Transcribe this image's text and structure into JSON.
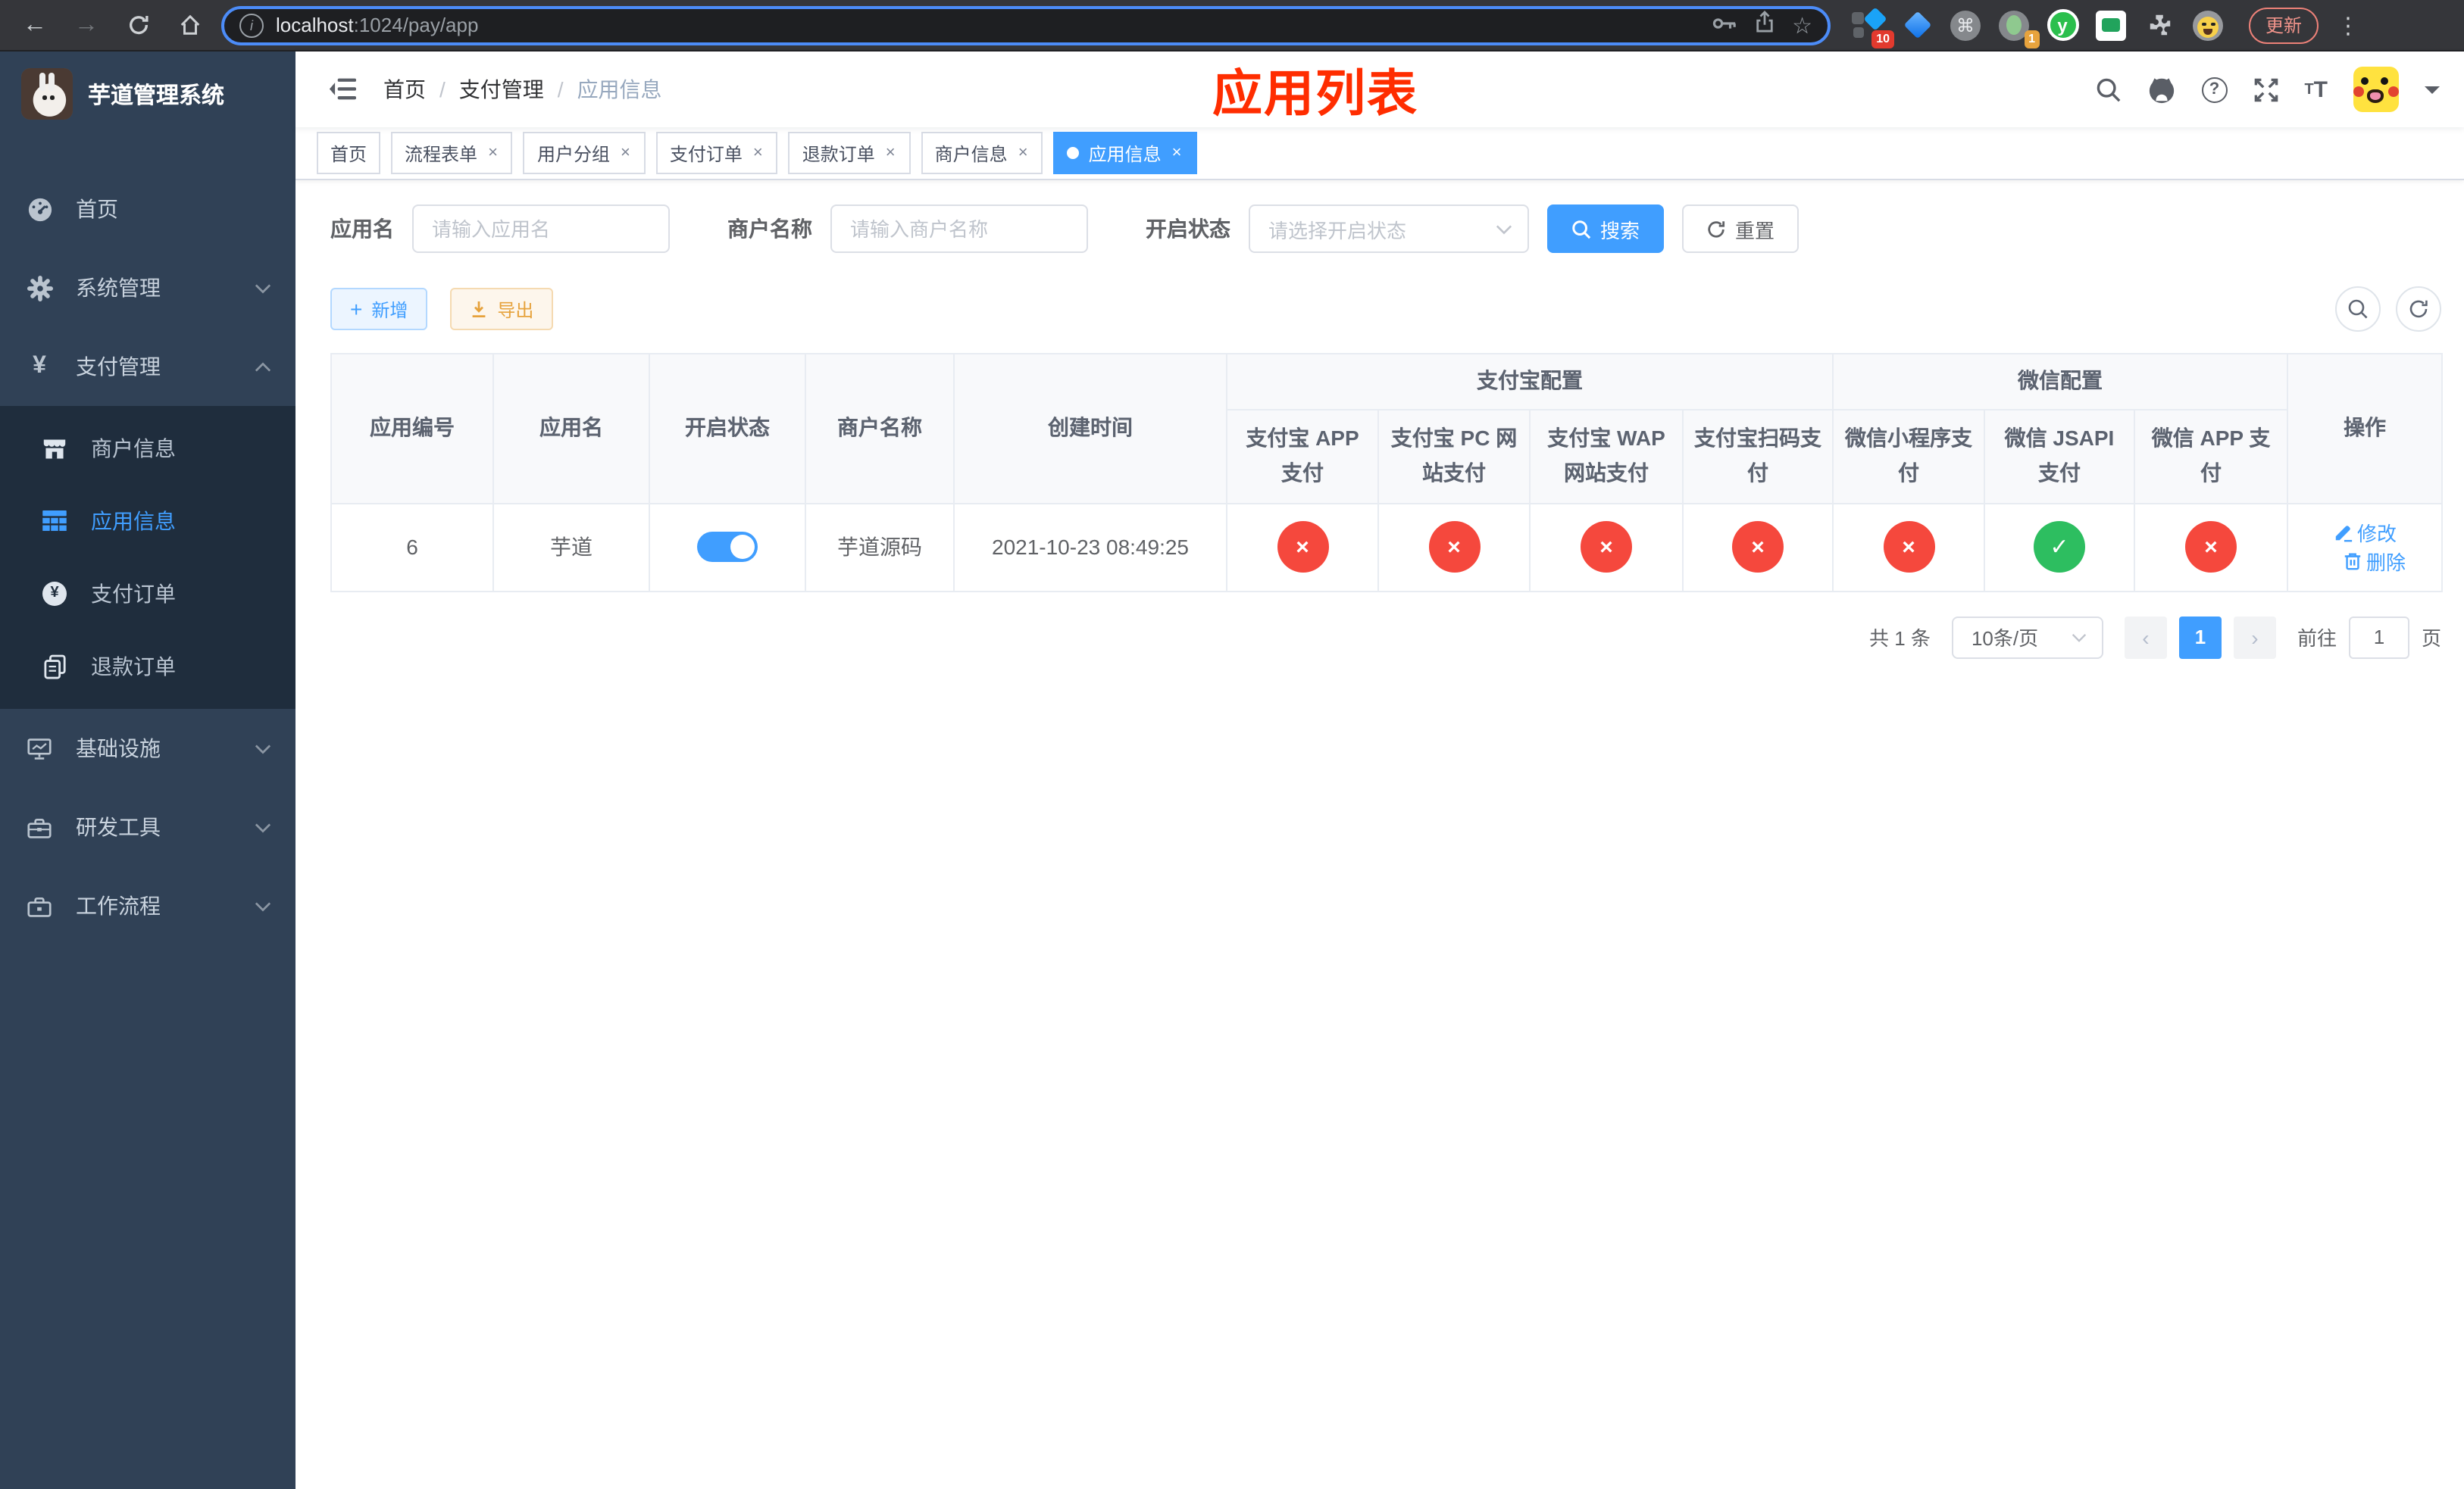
{
  "colors": {
    "primary": "#409eff",
    "success": "#2dbe60",
    "danger": "#f5483d",
    "warning": "#e6a23c",
    "page_title_red": "#ff2d00"
  },
  "browser": {
    "url_domain": "localhost",
    "url_path": ":1024/pay/app",
    "update_label": "更新",
    "extension_badge_blue": "10",
    "extension_badge_record": "1"
  },
  "sidebar": {
    "logo_title": "芋道管理系统",
    "top_items": [
      {
        "label": "首页"
      },
      {
        "label": "系统管理"
      },
      {
        "label": "支付管理"
      }
    ],
    "pay_submenu": [
      {
        "label": "商户信息"
      },
      {
        "label": "应用信息"
      },
      {
        "label": "支付订单"
      },
      {
        "label": "退款订单"
      }
    ],
    "bottom_items": [
      {
        "label": "基础设施"
      },
      {
        "label": "研发工具"
      },
      {
        "label": "工作流程"
      }
    ]
  },
  "header": {
    "breadcrumb": [
      "首页",
      "支付管理",
      "应用信息"
    ],
    "breadcrumb_separator": "/",
    "page_title": "应用列表"
  },
  "tabs": [
    {
      "label": "首页"
    },
    {
      "label": "流程表单"
    },
    {
      "label": "用户分组"
    },
    {
      "label": "支付订单"
    },
    {
      "label": "退款订单"
    },
    {
      "label": "商户信息"
    },
    {
      "label": "应用信息"
    }
  ],
  "filters": {
    "app_name_label": "应用名",
    "app_name_placeholder": "请输入应用名",
    "merchant_label": "商户名称",
    "merchant_placeholder": "请输入商户名称",
    "status_label": "开启状态",
    "status_placeholder": "请选择开启状态",
    "search_label": "搜索",
    "reset_label": "重置"
  },
  "toolbar": {
    "add_label": "新增",
    "export_label": "导出"
  },
  "table": {
    "columns_simple": [
      "应用编号",
      "应用名",
      "开启状态",
      "商户名称",
      "创建时间"
    ],
    "group_alipay": "支付宝配置",
    "group_wechat": "微信配置",
    "columns_alipay": [
      "支付宝 APP 支付",
      "支付宝 PC 网站支付",
      "支付宝 WAP 网站支付",
      "支付宝扫码支付"
    ],
    "columns_wechat": [
      "微信小程序支付",
      "微信 JSAPI 支付",
      "微信 APP 支付"
    ],
    "column_action": "操作",
    "rows": [
      {
        "id": "6",
        "name": "芋道",
        "enabled": true,
        "merchant": "芋道源码",
        "created_at": "2021-10-23 08:49:25",
        "pay_status": [
          false,
          false,
          false,
          false,
          false,
          true,
          false
        ],
        "action_edit": "修改",
        "action_delete": "删除"
      }
    ]
  },
  "pagination": {
    "total_text": "共 1 条",
    "page_size_text": "10条/页",
    "current_page": "1",
    "goto_label": "前往",
    "goto_value": "1",
    "goto_unit": "页"
  }
}
